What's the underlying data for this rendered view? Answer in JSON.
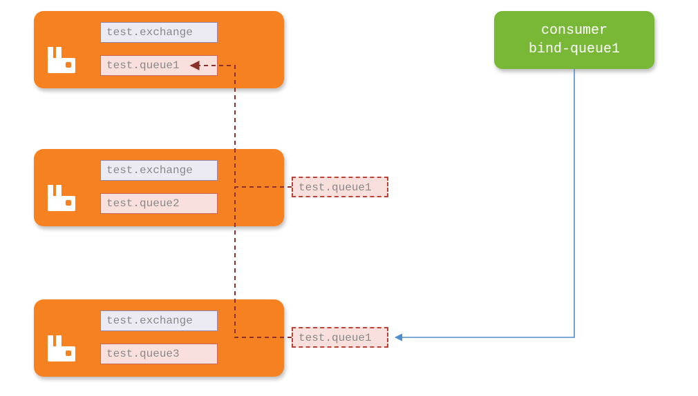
{
  "brokers": [
    {
      "exchange": "test.exchange",
      "queue": "test.queue1"
    },
    {
      "exchange": "test.exchange",
      "queue": "test.queue2"
    },
    {
      "exchange": "test.exchange",
      "queue": "test.queue3"
    }
  ],
  "ghost_queues": {
    "middle": "test.queue1",
    "bottom": "test.queue1"
  },
  "consumer": {
    "line1": "consumer",
    "line2": "bind-queue1"
  },
  "colors": {
    "broker_bg": "#f58120",
    "dashed": "#8b2f2a",
    "solid": "#4e8ecb",
    "consumer_bg": "#78b836"
  }
}
